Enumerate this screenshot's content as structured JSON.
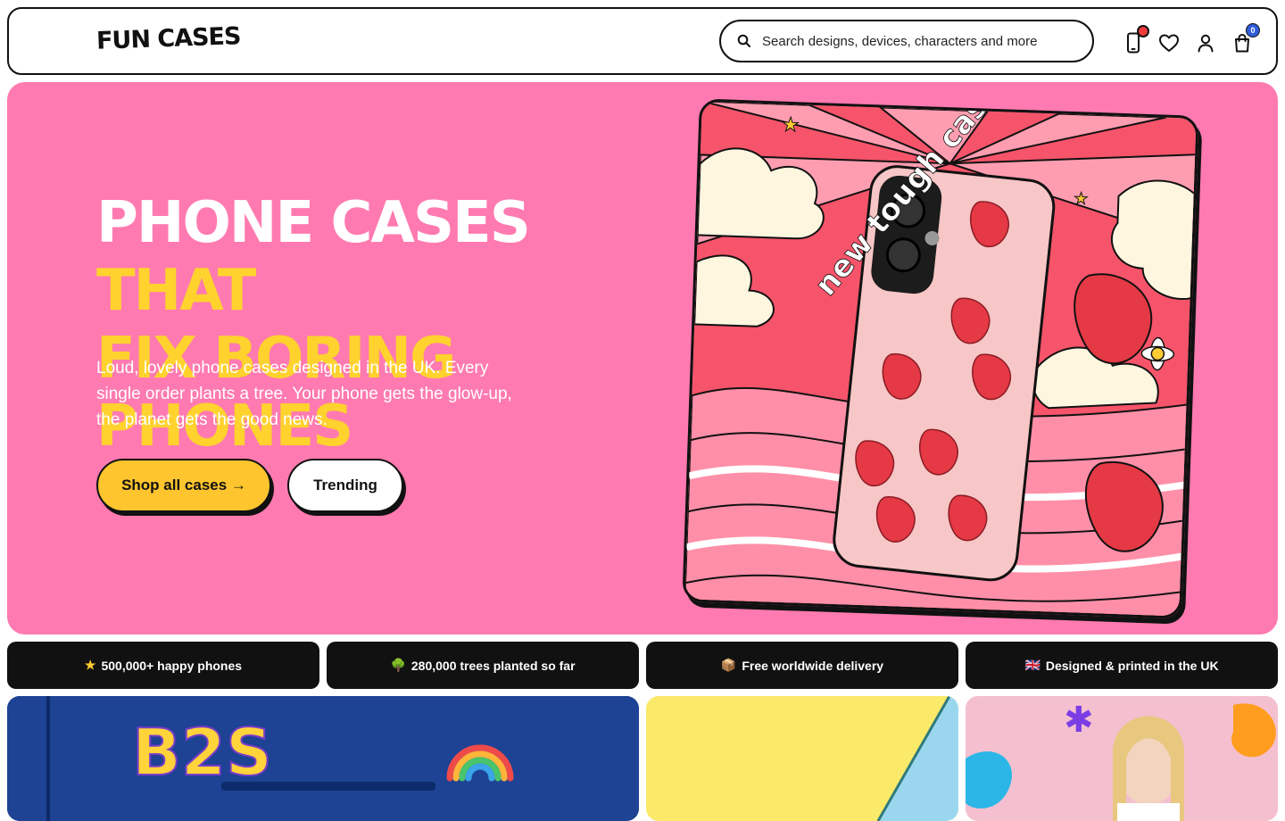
{
  "header": {
    "logo": "FUN CASES",
    "search_placeholder": "Search designs, devices, characters and more",
    "cart_count": "0"
  },
  "hero": {
    "title_white": "PHONE CASES",
    "title_yellow_1": "THAT",
    "title_yellow_2": "FIX BORING PHONES",
    "subtitle": "Loud, lovely phone cases designed in the UK. Every single order plants a tree. Your phone gets the glow-up, the planet gets the good news.",
    "primary_button": "Shop all cases →",
    "secondary_button": "Trending",
    "art_caption": "new tough cases"
  },
  "stats": [
    {
      "icon": "star-icon",
      "glyph": "★",
      "label": "500,000+ happy phones"
    },
    {
      "icon": "tree-icon",
      "glyph": "🌳",
      "label": "280,000 trees planted so far"
    },
    {
      "icon": "box-icon",
      "glyph": "📦",
      "label": "Free worldwide delivery"
    },
    {
      "icon": "uk-flag-icon",
      "glyph": "🇬🇧",
      "label": "Designed & printed in the UK"
    }
  ],
  "tiles": {
    "b2s_letters": "B2S"
  },
  "colors": {
    "hero_bg": "#ff7ab0",
    "accent_yellow": "#ffd22e",
    "button_yellow": "#ffc52e",
    "dark": "#111111"
  }
}
